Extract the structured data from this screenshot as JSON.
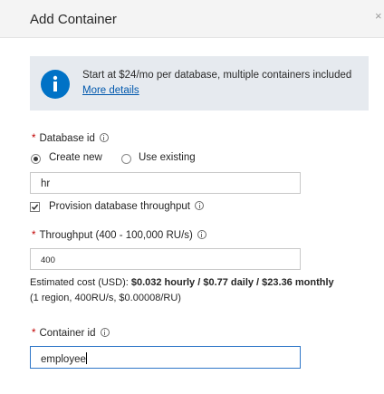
{
  "header": {
    "title": "Add Container",
    "close_glyph": "×"
  },
  "info": {
    "icon": "info-icon",
    "icon_color": "#0072c6",
    "text": "Start at $24/mo per database, multiple containers included",
    "link": "More details"
  },
  "database": {
    "label": "Database id",
    "required_marker": "*",
    "mode_options": [
      {
        "label": "Create new",
        "selected": true
      },
      {
        "label": "Use existing",
        "selected": false
      }
    ],
    "value": "hr"
  },
  "provision": {
    "label": "Provision database throughput",
    "checked": true
  },
  "throughput": {
    "label": "Throughput (400 - 100,000 RU/s)",
    "required_marker": "*",
    "value": "400"
  },
  "cost": {
    "prefix": "Estimated cost (USD): ",
    "amount": "$0.032 hourly / $0.77 daily / $23.36 monthly",
    "details": " (1 region, 400RU/s, $0.00008/RU)"
  },
  "container": {
    "label": "Container id",
    "required_marker": "*",
    "value": "employee"
  }
}
